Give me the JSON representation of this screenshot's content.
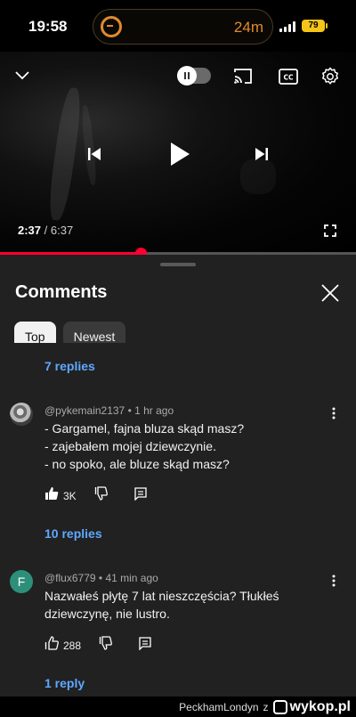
{
  "status_bar": {
    "time": "19:58",
    "activity_eta": "24m",
    "battery_level": "79"
  },
  "player": {
    "current_time": "2:37",
    "separator": " / ",
    "duration": "6:37",
    "progress_fraction": 0.395
  },
  "comments_panel": {
    "title": "Comments",
    "tabs": [
      {
        "label": "Top",
        "selected": true
      },
      {
        "label": "Newest",
        "selected": false
      }
    ],
    "thread_above": {
      "replies_label": "7 replies"
    },
    "comments": [
      {
        "author": "@pykemain2137",
        "time_ago": "1 hr ago",
        "avatar_letter": "",
        "text": "- Gargamel, fajna bluza skąd masz?\n- zajebałem mojej dziewczynie.\n- no spoko, ale bluze skąd masz?",
        "likes": "3K",
        "liked": true,
        "replies_label": "10 replies"
      },
      {
        "author": "@flux6779",
        "time_ago": "41 min ago",
        "avatar_letter": "F",
        "text": "Nazwałeś płytę 7 lat nieszczęścia? Tłukłeś dziewczynę, nie lustro.",
        "likes": "288",
        "liked": false,
        "replies_label": "1 reply"
      }
    ]
  },
  "watermark": {
    "user": "PeckhamLondyn",
    "via": "z",
    "site": "wykop.pl"
  },
  "colors": {
    "accent_red": "#ff0033",
    "link_blue": "#5fa8ff",
    "panel_bg": "#212121"
  }
}
